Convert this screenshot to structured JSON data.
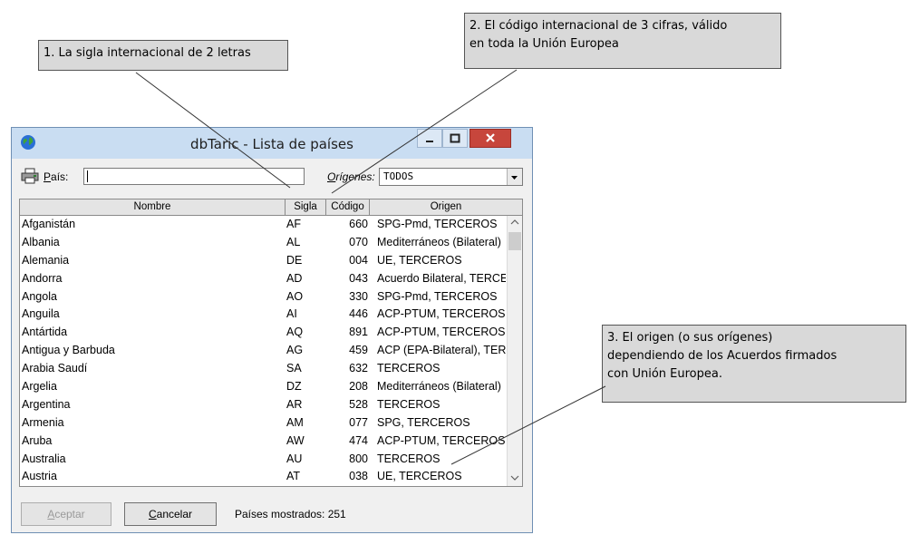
{
  "callouts": {
    "c1": "1. La sigla internacional de 2 letras",
    "c2_line1": "2. El código internacional de 3 cifras, válido",
    "c2_line2": "en toda la Unión Europea",
    "c3_line1": "3. El origen (o sus orígenes)",
    "c3_line2": "dependiendo de los Acuerdos firmados",
    "c3_line3": "con Unión Europea."
  },
  "window": {
    "title": "dbTaric - Lista de países",
    "icons": {
      "app": "globe-icon",
      "minimize": "minimize-icon",
      "maximize": "maximize-icon",
      "close": "close-icon",
      "print": "printer-icon"
    }
  },
  "filters": {
    "pais_label_accel": "P",
    "pais_label_rest": "aís:",
    "pais_value": "",
    "origenes_label_accel": "O",
    "origenes_label_rest": "rígenes:",
    "origenes_value": "TODOS"
  },
  "table": {
    "headers": {
      "nombre": "Nombre",
      "sigla": "Sigla",
      "codigo": "Código",
      "origen": "Origen"
    },
    "rows": [
      {
        "nombre": "Afganistán",
        "sigla": "AF",
        "codigo": "660",
        "origen": "SPG-Pmd, TERCEROS"
      },
      {
        "nombre": "Albania",
        "sigla": "AL",
        "codigo": "070",
        "origen": "Mediterráneos (Bilateral)"
      },
      {
        "nombre": "Alemania",
        "sigla": "DE",
        "codigo": "004",
        "origen": "UE, TERCEROS"
      },
      {
        "nombre": "Andorra",
        "sigla": "AD",
        "codigo": "043",
        "origen": "Acuerdo Bilateral, TERCEROS"
      },
      {
        "nombre": "Angola",
        "sigla": "AO",
        "codigo": "330",
        "origen": "SPG-Pmd, TERCEROS"
      },
      {
        "nombre": "Anguila",
        "sigla": "AI",
        "codigo": "446",
        "origen": "ACP-PTUM, TERCEROS"
      },
      {
        "nombre": "Antártida",
        "sigla": "AQ",
        "codigo": "891",
        "origen": "ACP-PTUM, TERCEROS"
      },
      {
        "nombre": "Antigua y Barbuda",
        "sigla": "AG",
        "codigo": "459",
        "origen": "ACP (EPA-Bilateral), TERCEROS"
      },
      {
        "nombre": "Arabia Saudí",
        "sigla": "SA",
        "codigo": "632",
        "origen": "TERCEROS"
      },
      {
        "nombre": "Argelia",
        "sigla": "DZ",
        "codigo": "208",
        "origen": "Mediterráneos (Bilateral)"
      },
      {
        "nombre": "Argentina",
        "sigla": "AR",
        "codigo": "528",
        "origen": "TERCEROS"
      },
      {
        "nombre": "Armenia",
        "sigla": "AM",
        "codigo": "077",
        "origen": "SPG, TERCEROS"
      },
      {
        "nombre": "Aruba",
        "sigla": "AW",
        "codigo": "474",
        "origen": "ACP-PTUM, TERCEROS"
      },
      {
        "nombre": "Australia",
        "sigla": "AU",
        "codigo": "800",
        "origen": "TERCEROS"
      },
      {
        "nombre": "Austria",
        "sigla": "AT",
        "codigo": "038",
        "origen": "UE, TERCEROS"
      }
    ]
  },
  "footer": {
    "aceptar_accel": "A",
    "aceptar_rest": "ceptar",
    "cancelar_accel": "C",
    "cancelar_rest": "ancelar",
    "count_text": "Países mostrados: 251"
  },
  "colors": {
    "callout_bg": "#d9d9d9",
    "titlebar": "#c9ddf2",
    "close_button": "#c7463c"
  }
}
